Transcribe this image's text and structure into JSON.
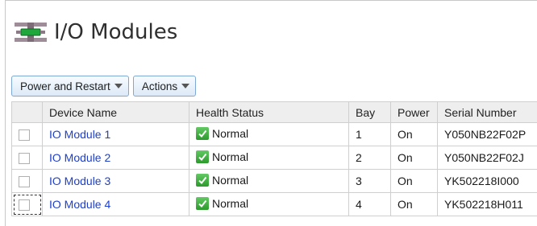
{
  "page": {
    "title": "I/O Modules",
    "icon": "io-module-icon"
  },
  "toolbar": {
    "power_restart_label": "Power and Restart",
    "actions_label": "Actions"
  },
  "table": {
    "columns": [
      "Device Name",
      "Health Status",
      "Bay",
      "Power",
      "Serial Number"
    ],
    "rows": [
      {
        "name": "IO Module 1",
        "health": "Normal",
        "bay": "1",
        "power": "On",
        "serial": "Y050NB22F02P"
      },
      {
        "name": "IO Module 2",
        "health": "Normal",
        "bay": "2",
        "power": "On",
        "serial": "Y050NB22F02J"
      },
      {
        "name": "IO Module 3",
        "health": "Normal",
        "bay": "3",
        "power": "On",
        "serial": "YK502218I000"
      },
      {
        "name": "IO Module 4",
        "health": "Normal",
        "bay": "4",
        "power": "On",
        "serial": "YK502218H011"
      }
    ]
  },
  "colors": {
    "link": "#1f40c9",
    "button_border": "#7fa8d4",
    "status_ok": "#2b9a2b"
  }
}
